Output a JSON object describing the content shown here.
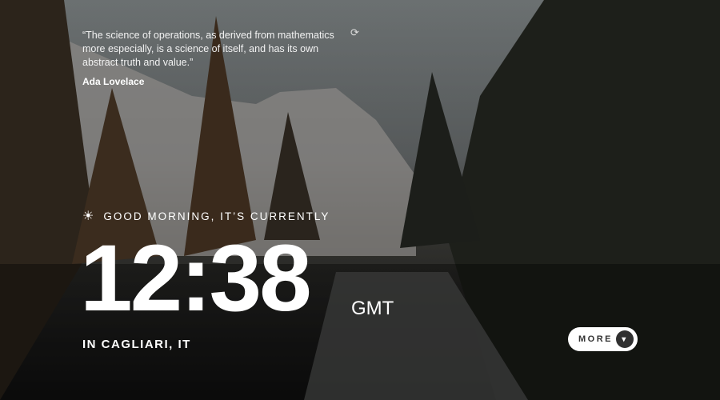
{
  "quote": {
    "text": "“The science of operations, as derived from mathematics more especially, is a science of itself, and has its own abstract truth and value.”",
    "author": "Ada Lovelace",
    "refresh_icon": "refresh-icon"
  },
  "greeting": {
    "icon": "sun-icon",
    "text": "GOOD MORNING, IT’S CURRENTLY"
  },
  "clock": {
    "time": "12:38",
    "timezone": "GMT"
  },
  "location": "IN CAGLIARI, IT",
  "more_button": {
    "label": "MORE",
    "icon": "chevron-down-icon"
  }
}
